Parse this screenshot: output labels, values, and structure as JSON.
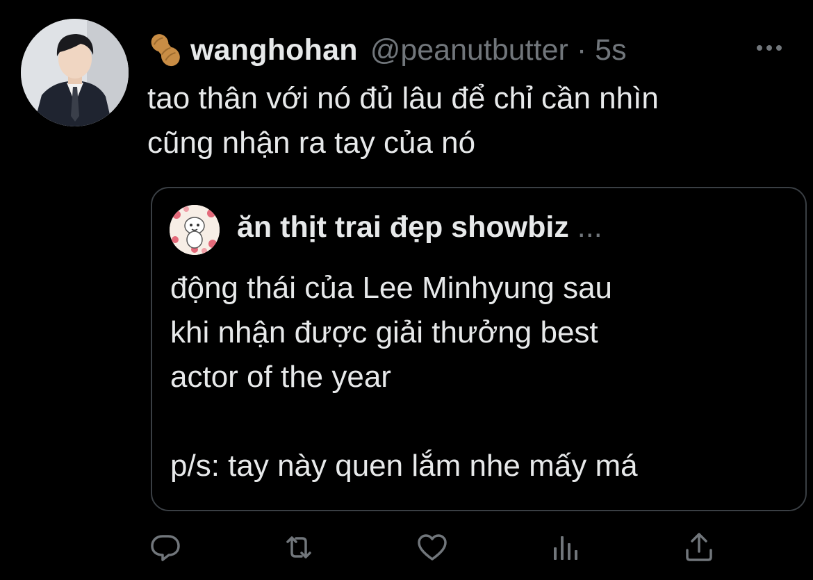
{
  "tweet": {
    "display_name": "wanghohan",
    "handle": "@peanutbutter",
    "separator": "·",
    "time": "5s",
    "text": "tao thân với nó đủ lâu để chỉ cần nhìn\ncũng nhận ra tay của nó",
    "name_icon": "peanut-icon",
    "more_icon": "more-horizontal-icon"
  },
  "quote": {
    "display_name": "ăn thịt trai đẹp showbiz",
    "ellipsis": "...",
    "text": "động thái của Lee Minhyung sau\nkhi nhận được giải thưởng best\nactor of the year\n\np/s: tay này quen lắm nhe mấy má"
  },
  "actions": [
    {
      "icon": "reply-icon"
    },
    {
      "icon": "retweet-icon"
    },
    {
      "icon": "like-icon"
    },
    {
      "icon": "analytics-icon"
    },
    {
      "icon": "share-icon"
    }
  ],
  "colors": {
    "background": "#000000",
    "text_primary": "#e7e9ea",
    "text_secondary": "#71767b",
    "border": "#3a3f44"
  }
}
